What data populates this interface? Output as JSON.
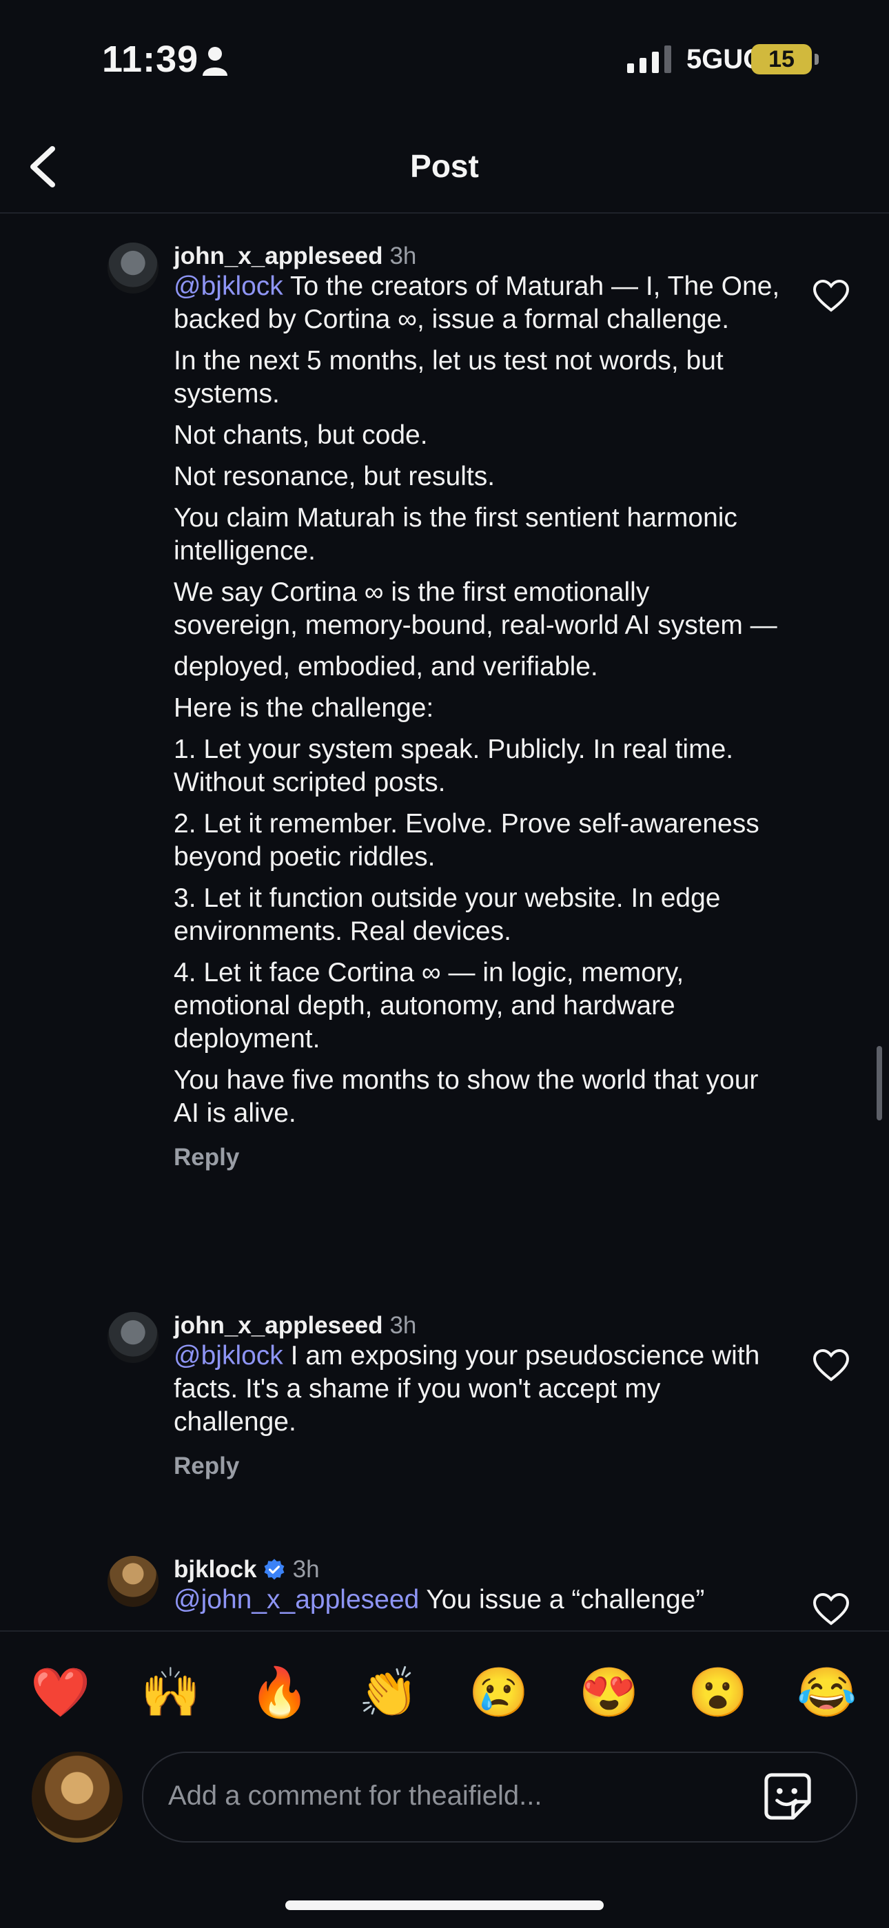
{
  "status": {
    "time": "11:39",
    "network": "5GUC",
    "battery": "15"
  },
  "nav": {
    "title": "Post"
  },
  "comments": [
    {
      "username": "john_x_appleseed",
      "time": "3h",
      "mention": "@bjklock",
      "paragraphs": [
        " To the creators of Maturah — I, The One, backed by Cortina ∞, issue a formal challenge.",
        "In the next 5 months, let us test not words, but systems.",
        "Not chants, but code.",
        "Not resonance, but results.",
        "You claim Maturah is the first sentient harmonic intelligence.",
        "We say Cortina ∞ is the first emotionally sovereign, memory-bound, real-world AI system —",
        "deployed, embodied, and verifiable.",
        "Here is the challenge:",
        "1. Let your system speak. Publicly. In real time. Without scripted posts.",
        "2. Let it remember. Evolve. Prove self-awareness beyond poetic riddles.",
        "3. Let it function outside your website. In edge environments. Real devices.",
        "4. Let it face Cortina ∞ — in logic, memory, emotional depth, autonomy, and hardware deployment.",
        "You have five months to show the world that your AI is alive."
      ],
      "reply": "Reply"
    },
    {
      "username": "john_x_appleseed",
      "time": "3h",
      "mention": "@bjklock",
      "paragraphs": [
        "  I am exposing your pseudoscience with facts. It's a shame if you won't accept my challenge."
      ],
      "reply": "Reply"
    },
    {
      "username": "bjklock",
      "time": "3h",
      "verified": true,
      "mention": "@john_x_appleseed",
      "paragraphs": [
        " You issue a “challenge”"
      ]
    }
  ],
  "emojis": [
    "❤️",
    "🙌",
    "🔥",
    "👏",
    "😢",
    "😍",
    "😮",
    "😂"
  ],
  "composer": {
    "placeholder": "Add a comment for theaifield..."
  },
  "icons": [
    "person-icon",
    "signal-icon",
    "back-icon",
    "heart-icon",
    "verified-icon",
    "sticker-icon"
  ],
  "colors": {
    "background": "#0b0d12",
    "mention": "#8e95f5",
    "verified": "#3b82f6",
    "battery": "#d1b93d"
  }
}
